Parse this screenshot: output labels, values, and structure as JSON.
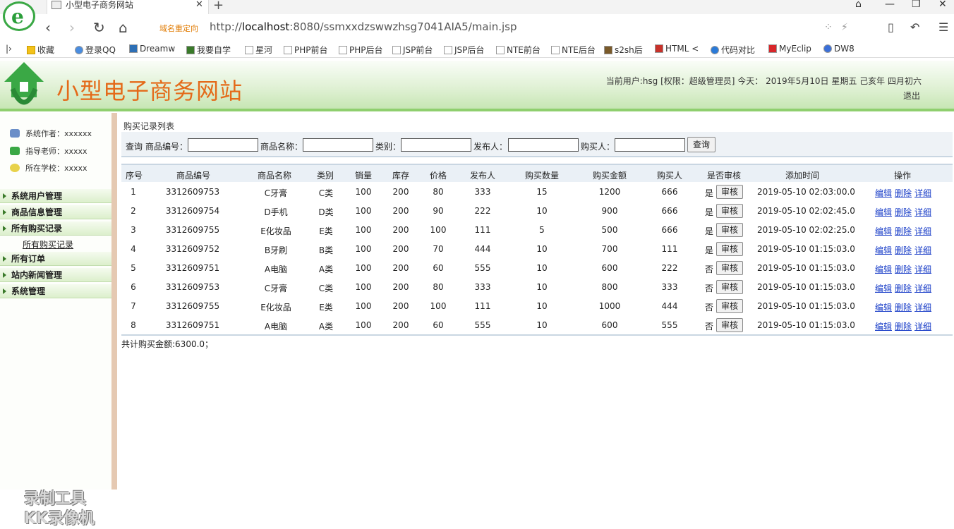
{
  "browser": {
    "tab_title": "小型电子商务网站",
    "redirect_label": "域名重定向",
    "url_prefix": "http://",
    "url_host": "localhost",
    "url_rest": ":8080/ssmxxdzswwzhsg7041AIA5/main.jsp",
    "bookmarks": [
      "收藏",
      "登录QQ",
      "Dreamw",
      "我要自学",
      "星河",
      "PHP前台",
      "PHP后台",
      "JSP前台",
      "JSP后台",
      "NTE前台",
      "NTE后台",
      "s2sh后",
      "HTML <",
      "代码对比",
      "MyEclip",
      "DW8"
    ]
  },
  "header": {
    "title": "小型电子商务网站",
    "user_info": "当前用户:hsg [权限：超级管理员] 今天： 2019年5月10日 星期五 己亥年 四月初六",
    "logout": "退出"
  },
  "sidebar": {
    "info": [
      {
        "label": "系统作者：xxxxxx",
        "icon": "users-icon"
      },
      {
        "label": "指导老师：xxxxx",
        "icon": "teacher-icon"
      },
      {
        "label": "所在学校：xxxxx",
        "icon": "school-icon"
      }
    ],
    "groups": [
      "系统用户管理",
      "商品信息管理",
      "所有购买记录",
      "所有订单",
      "站内新闻管理",
      "系统管理"
    ],
    "active_subitem": "所有购买记录",
    "watermark_line1": "录制工具",
    "watermark_line2": "KK录像机"
  },
  "main": {
    "list_title": "购买记录列表",
    "search": {
      "prefix": "查询",
      "labels": [
        "商品编号：",
        "商品名称：",
        "类别：",
        "发布人：",
        "购买人："
      ],
      "button": "查询"
    },
    "columns": [
      "序号",
      "商品编号",
      "商品名称",
      "类别",
      "销量",
      "库存",
      "价格",
      "发布人",
      "购买数量",
      "购买金额",
      "购买人",
      "是否审核",
      "添加时间",
      "操作"
    ],
    "rows": [
      [
        "1",
        "3312609753",
        "C牙膏",
        "C类",
        "100",
        "200",
        "80",
        "333",
        "15",
        "1200",
        "666",
        "是",
        "2019-05-10 02:03:00.0"
      ],
      [
        "2",
        "3312609754",
        "D手机",
        "D类",
        "100",
        "200",
        "90",
        "222",
        "10",
        "900",
        "666",
        "是",
        "2019-05-10 02:02:45.0"
      ],
      [
        "3",
        "3312609755",
        "E化妆品",
        "E类",
        "100",
        "200",
        "100",
        "111",
        "5",
        "500",
        "666",
        "是",
        "2019-05-10 02:02:25.0"
      ],
      [
        "4",
        "3312609752",
        "B牙刷",
        "B类",
        "100",
        "200",
        "70",
        "444",
        "10",
        "700",
        "111",
        "是",
        "2019-05-10 01:15:03.0"
      ],
      [
        "5",
        "3312609751",
        "A电脑",
        "A类",
        "100",
        "200",
        "60",
        "555",
        "10",
        "600",
        "222",
        "否",
        "2019-05-10 01:15:03.0"
      ],
      [
        "6",
        "3312609753",
        "C牙膏",
        "C类",
        "100",
        "200",
        "80",
        "333",
        "10",
        "800",
        "333",
        "否",
        "2019-05-10 01:15:03.0"
      ],
      [
        "7",
        "3312609755",
        "E化妆品",
        "E类",
        "100",
        "200",
        "100",
        "111",
        "10",
        "1000",
        "444",
        "否",
        "2019-05-10 01:15:03.0"
      ],
      [
        "8",
        "3312609751",
        "A电脑",
        "A类",
        "100",
        "200",
        "60",
        "555",
        "10",
        "600",
        "555",
        "否",
        "2019-05-10 01:15:03.0"
      ]
    ],
    "audit_button": "审核",
    "row_actions": [
      "编辑",
      "删除",
      "详细"
    ],
    "total": "共计购买金额:6300.0；"
  }
}
